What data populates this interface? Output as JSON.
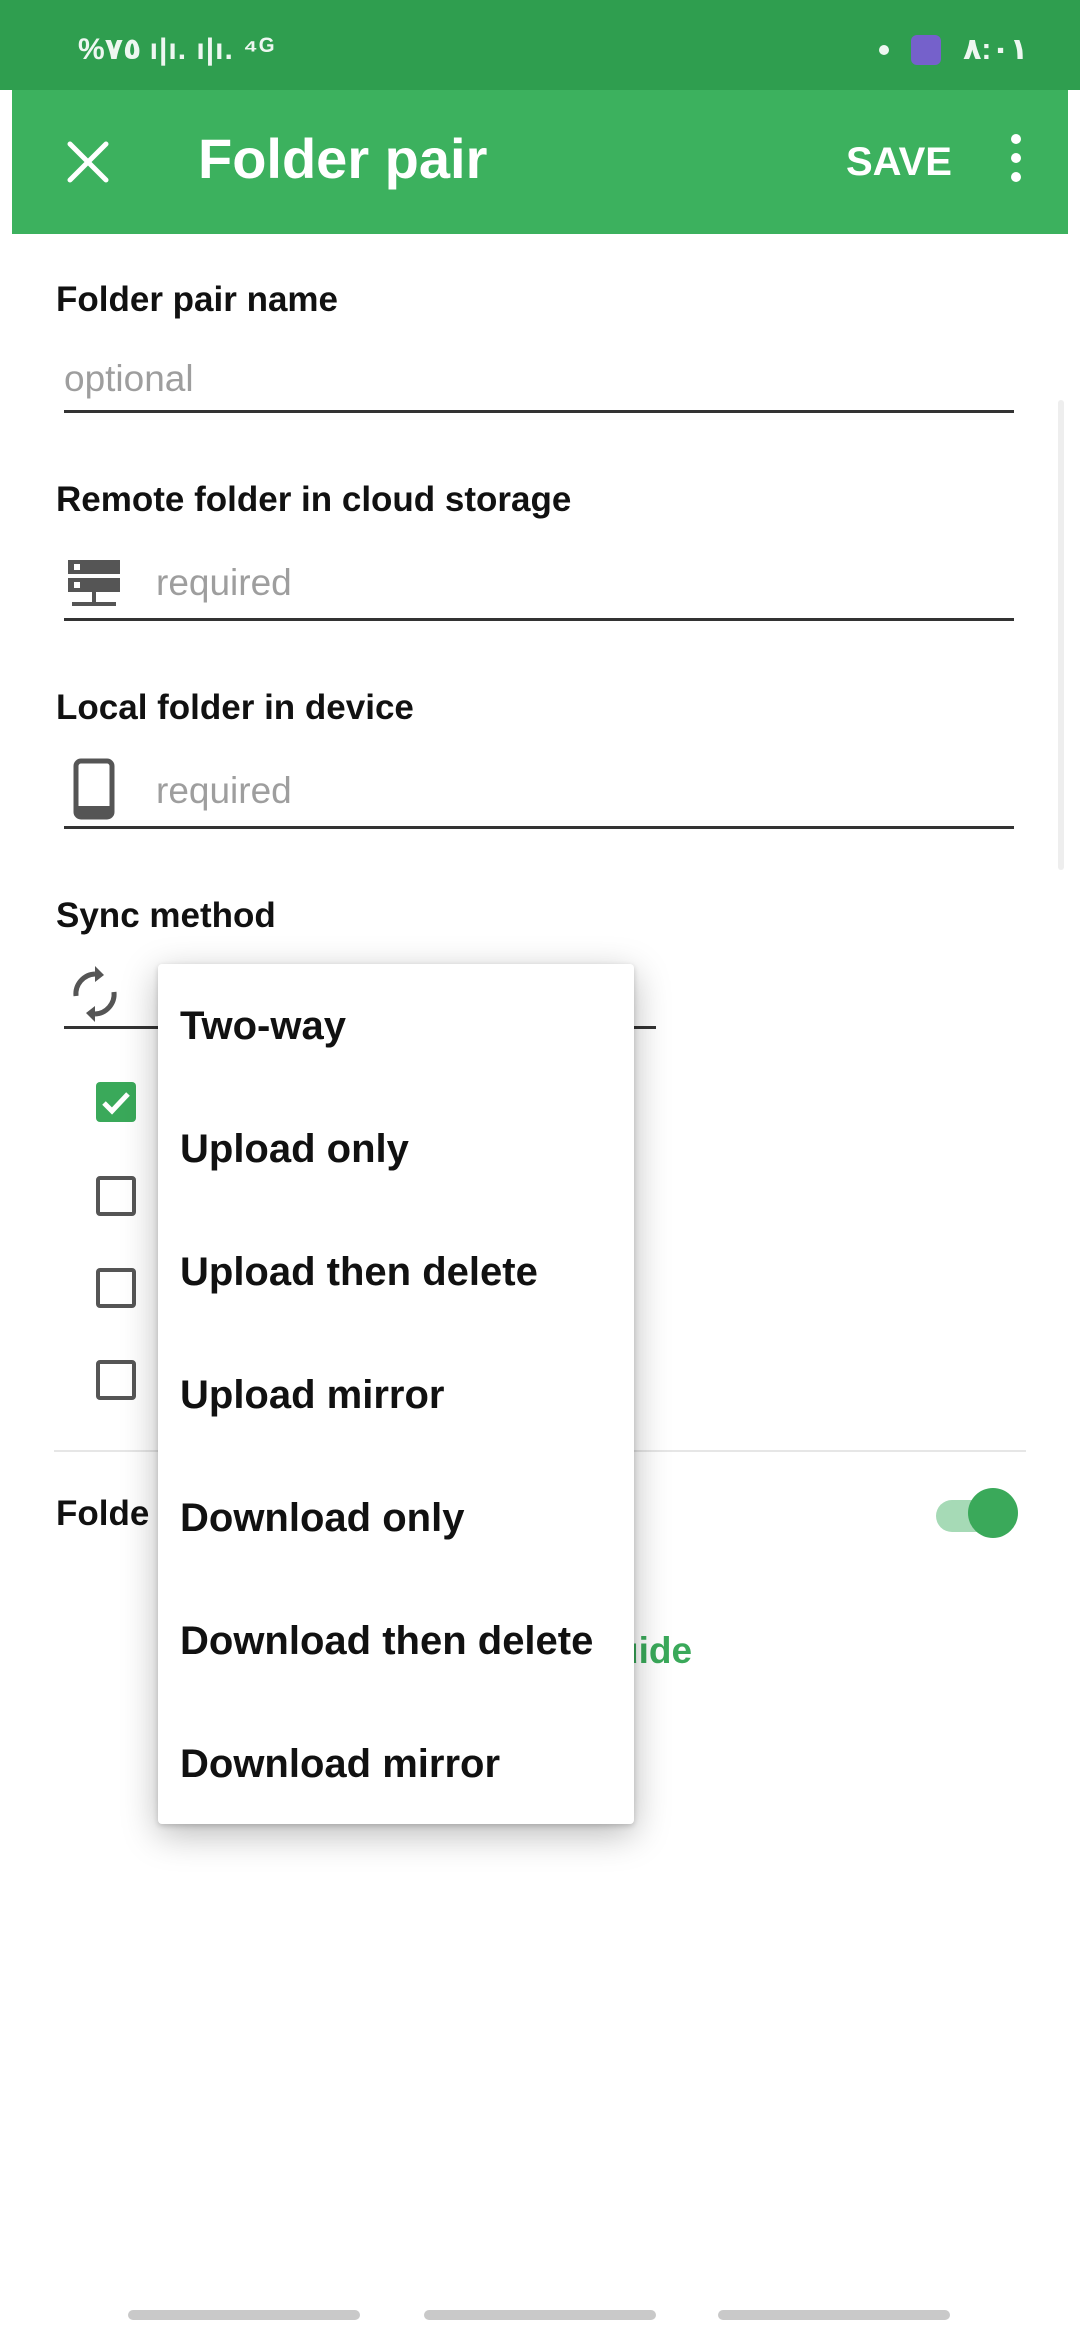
{
  "status_bar": {
    "left_text": "%٧٥ ı|ı. ı|ı. ⁴ᴳ",
    "right_text": "٨:٠١"
  },
  "app_bar": {
    "title": "Folder pair",
    "save_label": "SAVE",
    "close_icon": "close-icon",
    "more_icon": "more-vert-icon"
  },
  "form": {
    "folder_pair_name": {
      "label": "Folder pair name",
      "placeholder": "optional"
    },
    "remote_folder": {
      "label": "Remote folder in cloud storage",
      "placeholder": "required",
      "icon": "server-icon"
    },
    "local_folder": {
      "label": "Local folder in device",
      "placeholder": "required",
      "icon": "phone-icon"
    },
    "sync_method": {
      "label": "Sync method",
      "icon": "sync-icon"
    },
    "checkboxes": [
      {
        "checked": true
      },
      {
        "checked": false
      },
      {
        "checked": false
      },
      {
        "checked": false
      }
    ],
    "folder_row_label": "Folde",
    "guide_link": "uide",
    "toggle_on": true
  },
  "dropdown": {
    "items": [
      "Two-way",
      "Upload only",
      "Upload then delete",
      "Upload mirror",
      "Download only",
      "Download then delete",
      "Download mirror"
    ]
  },
  "colors": {
    "status_bar": "#2f9e4f",
    "app_bar": "#3cb15e",
    "accent": "#3aa95a"
  }
}
